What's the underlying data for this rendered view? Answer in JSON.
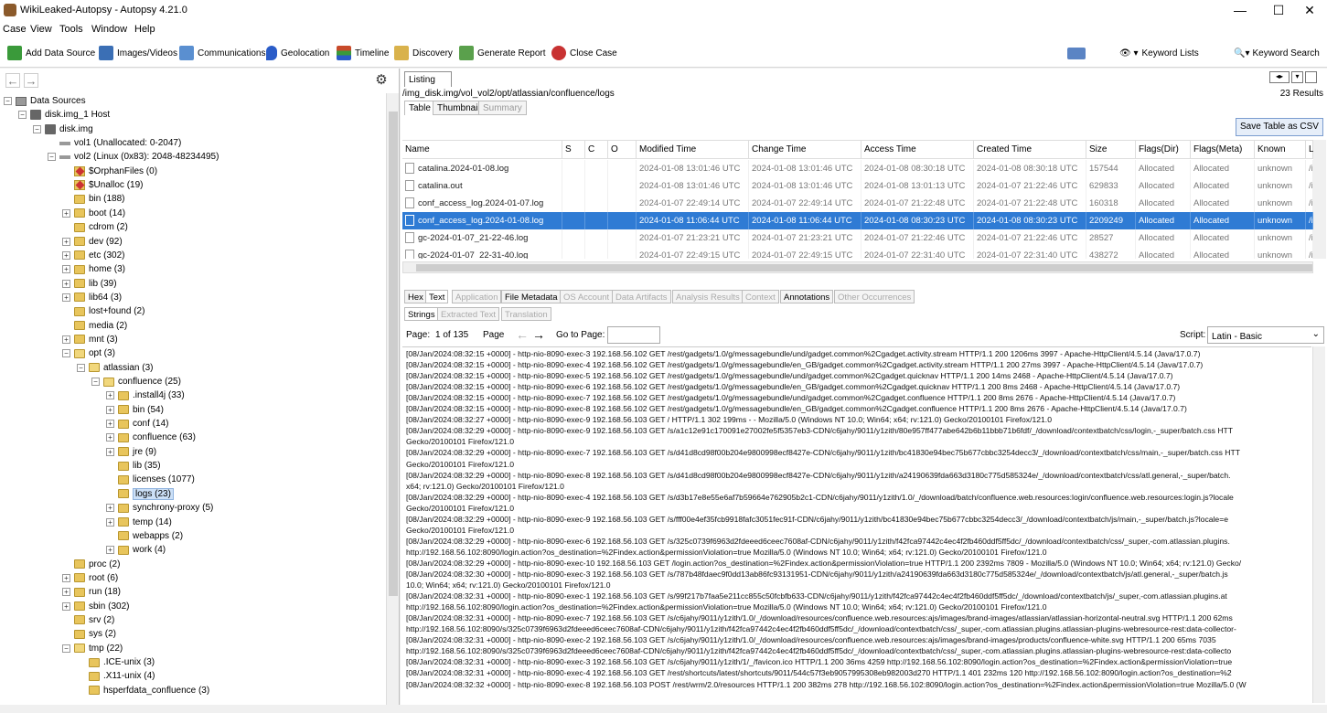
{
  "window": {
    "title": "WikiLeaked-Autopsy - Autopsy 4.21.0",
    "minimize": "—",
    "maximize": "☐",
    "close": "✕"
  },
  "menu": [
    "Case",
    "View",
    "Tools",
    "Window",
    "Help"
  ],
  "toolbar": {
    "add_data_source": "Add Data Source",
    "images_videos": "Images/Videos",
    "communications": "Communications",
    "geolocation": "Geolocation",
    "timeline": "Timeline",
    "discovery": "Discovery",
    "generate_report": "Generate Report",
    "close_case": "Close Case",
    "keyword_lists": "Keyword Lists",
    "keyword_search": "Keyword Search",
    "colors": {
      "add": "#3a9a3a",
      "images": "#3b6fb5",
      "comms": "#5a8fd0",
      "geo": "#2a5cc8",
      "timeline": "#c84a2a",
      "discovery": "#d9b24c",
      "report": "#5aa04c",
      "close": "#c83232"
    }
  },
  "tree": [
    {
      "label": "Data Sources",
      "toggle": "−",
      "icon": "ds"
    },
    {
      "label": "disk.img_1 Host",
      "toggle": "−",
      "icon": "disk"
    },
    {
      "label": "disk.img",
      "toggle": "−",
      "icon": "disk"
    },
    {
      "label": "vol1 (Unallocated: 0-2047)",
      "toggle": "",
      "icon": "vol"
    },
    {
      "label": "vol2 (Linux (0x83): 2048-48234495)",
      "toggle": "−",
      "icon": "vol"
    },
    {
      "label": "$OrphanFiles (0)",
      "toggle": "",
      "icon": "fx"
    },
    {
      "label": "$Unalloc (19)",
      "toggle": "",
      "icon": "fx"
    },
    {
      "label": "bin (188)",
      "toggle": "",
      "icon": "fd"
    },
    {
      "label": "boot (14)",
      "toggle": "+",
      "icon": "fd"
    },
    {
      "label": "cdrom (2)",
      "toggle": "",
      "icon": "fd"
    },
    {
      "label": "dev (92)",
      "toggle": "+",
      "icon": "fd"
    },
    {
      "label": "etc (302)",
      "toggle": "+",
      "icon": "fd"
    },
    {
      "label": "home (3)",
      "toggle": "+",
      "icon": "fd"
    },
    {
      "label": "lib (39)",
      "toggle": "+",
      "icon": "fd"
    },
    {
      "label": "lib64 (3)",
      "toggle": "+",
      "icon": "fd"
    },
    {
      "label": "lost+found (2)",
      "toggle": "",
      "icon": "fd"
    },
    {
      "label": "media (2)",
      "toggle": "",
      "icon": "fd"
    },
    {
      "label": "mnt (3)",
      "toggle": "+",
      "icon": "fd"
    },
    {
      "label": "opt (3)",
      "toggle": "−",
      "icon": "fdo"
    },
    {
      "label": "atlassian (3)",
      "toggle": "−",
      "icon": "fdo"
    },
    {
      "label": "confluence (25)",
      "toggle": "−",
      "icon": "fdo"
    },
    {
      "label": ".install4j (33)",
      "toggle": "+",
      "icon": "fd"
    },
    {
      "label": "bin (54)",
      "toggle": "+",
      "icon": "fd"
    },
    {
      "label": "conf (14)",
      "toggle": "+",
      "icon": "fd"
    },
    {
      "label": "confluence (63)",
      "toggle": "+",
      "icon": "fd"
    },
    {
      "label": "jre (9)",
      "toggle": "+",
      "icon": "fd"
    },
    {
      "label": "lib (35)",
      "toggle": "",
      "icon": "fd"
    },
    {
      "label": "licenses (1077)",
      "toggle": "",
      "icon": "fd"
    },
    {
      "label": "logs (23)",
      "toggle": "",
      "icon": "fd",
      "selected": true
    },
    {
      "label": "synchrony-proxy (5)",
      "toggle": "+",
      "icon": "fd"
    },
    {
      "label": "temp (14)",
      "toggle": "+",
      "icon": "fd"
    },
    {
      "label": "webapps (2)",
      "toggle": "",
      "icon": "fd"
    },
    {
      "label": "work (4)",
      "toggle": "+",
      "icon": "fd"
    },
    {
      "label": "proc (2)",
      "toggle": "",
      "icon": "fd"
    },
    {
      "label": "root (6)",
      "toggle": "+",
      "icon": "fd"
    },
    {
      "label": "run (18)",
      "toggle": "+",
      "icon": "fd"
    },
    {
      "label": "sbin (302)",
      "toggle": "+",
      "icon": "fd"
    },
    {
      "label": "srv (2)",
      "toggle": "",
      "icon": "fd"
    },
    {
      "label": "sys (2)",
      "toggle": "",
      "icon": "fd"
    },
    {
      "label": "tmp (22)",
      "toggle": "−",
      "icon": "fdo"
    },
    {
      "label": ".ICE-unix (3)",
      "toggle": "",
      "icon": "fd"
    },
    {
      "label": ".X11-unix (4)",
      "toggle": "",
      "icon": "fd"
    },
    {
      "label": "hsperfdata_confluence (3)",
      "toggle": "",
      "icon": "fd"
    }
  ],
  "listing": {
    "tab": "Listing",
    "path": "/img_disk.img/vol_vol2/opt/atlassian/confluence/logs",
    "result_count": "23 Results",
    "view_tabs": [
      "Table",
      "Thumbnail",
      "Summary"
    ],
    "save_csv": "Save Table as CSV",
    "columns": [
      "Name",
      "S",
      "C",
      "O",
      "Modified Time",
      "Change Time",
      "Access Time",
      "Created Time",
      "Size",
      "Flags(Dir)",
      "Flags(Meta)",
      "Known",
      "L"
    ],
    "rows": [
      [
        "catalina.2024-01-08.log",
        "",
        "",
        "",
        "2024-01-08 13:01:46 UTC",
        "2024-01-08 13:01:46 UTC",
        "2024-01-08 08:30:18 UTC",
        "2024-01-08 08:30:18 UTC",
        "157544",
        "Allocated",
        "Allocated",
        "unknown",
        "/i"
      ],
      [
        "catalina.out",
        "",
        "",
        "",
        "2024-01-08 13:01:46 UTC",
        "2024-01-08 13:01:46 UTC",
        "2024-01-08 13:01:13 UTC",
        "2024-01-07 21:22:46 UTC",
        "629833",
        "Allocated",
        "Allocated",
        "unknown",
        "/i"
      ],
      [
        "conf_access_log.2024-01-07.log",
        "",
        "",
        "",
        "2024-01-07 22:49:14 UTC",
        "2024-01-07 22:49:14 UTC",
        "2024-01-07 21:22:48 UTC",
        "2024-01-07 21:22:48 UTC",
        "160318",
        "Allocated",
        "Allocated",
        "unknown",
        "/i"
      ],
      [
        "conf_access_log.2024-01-08.log",
        "",
        "",
        "",
        "2024-01-08 11:06:44 UTC",
        "2024-01-08 11:06:44 UTC",
        "2024-01-08 08:30:23 UTC",
        "2024-01-08 08:30:23 UTC",
        "2209249",
        "Allocated",
        "Allocated",
        "unknown",
        "/i"
      ],
      [
        "gc-2024-01-07_21-22-46.log",
        "",
        "",
        "",
        "2024-01-07 21:23:21 UTC",
        "2024-01-07 21:23:21 UTC",
        "2024-01-07 21:22:46 UTC",
        "2024-01-07 21:22:46 UTC",
        "28527",
        "Allocated",
        "Allocated",
        "unknown",
        "/i"
      ],
      [
        "gc-2024-01-07_22-31-40.log",
        "",
        "",
        "",
        "2024-01-07 22:49:15 UTC",
        "2024-01-07 22:49:15 UTC",
        "2024-01-07 22:31:40 UTC",
        "2024-01-07 22:31:40 UTC",
        "438272",
        "Allocated",
        "Allocated",
        "unknown",
        "/i"
      ]
    ],
    "selected_row": 3
  },
  "content": {
    "tabs": [
      "Hex",
      "Text",
      "Application",
      "File Metadata",
      "OS Account",
      "Data Artifacts",
      "Analysis Results",
      "Context",
      "Annotations",
      "Other Occurrences"
    ],
    "subtabs": [
      "Strings",
      "Extracted Text",
      "Translation"
    ],
    "page_label": "Page:",
    "page_of": "1 of 135",
    "page_word": "Page",
    "goto_label": "Go to Page:",
    "script_label": "Script:",
    "script_value": "Latin - Basic",
    "lines": [
      "[08/Jan/2024:08:32:15 +0000] - http-nio-8090-exec-3 192.168.56.102 GET /rest/gadgets/1.0/g/messagebundle/und/gadget.common%2Cgadget.activity.stream HTTP/1.1 200 1206ms 3997 - Apache-HttpClient/4.5.14 (Java/17.0.7)",
      "[08/Jan/2024:08:32:15 +0000] - http-nio-8090-exec-4 192.168.56.102 GET /rest/gadgets/1.0/g/messagebundle/en_GB/gadget.common%2Cgadget.activity.stream HTTP/1.1 200 27ms 3997 - Apache-HttpClient/4.5.14 (Java/17.0.7)",
      "[08/Jan/2024:08:32:15 +0000] - http-nio-8090-exec-5 192.168.56.102 GET /rest/gadgets/1.0/g/messagebundle/und/gadget.common%2Cgadget.quicknav HTTP/1.1 200 14ms 2468 - Apache-HttpClient/4.5.14 (Java/17.0.7)",
      "[08/Jan/2024:08:32:15 +0000] - http-nio-8090-exec-6 192.168.56.102 GET /rest/gadgets/1.0/g/messagebundle/en_GB/gadget.common%2Cgadget.quicknav HTTP/1.1 200 8ms 2468 - Apache-HttpClient/4.5.14 (Java/17.0.7)",
      "[08/Jan/2024:08:32:15 +0000] - http-nio-8090-exec-7 192.168.56.102 GET /rest/gadgets/1.0/g/messagebundle/und/gadget.common%2Cgadget.confluence HTTP/1.1 200 8ms 2676 - Apache-HttpClient/4.5.14 (Java/17.0.7)",
      "[08/Jan/2024:08:32:15 +0000] - http-nio-8090-exec-8 192.168.56.102 GET /rest/gadgets/1.0/g/messagebundle/en_GB/gadget.common%2Cgadget.confluence HTTP/1.1 200 8ms 2676 - Apache-HttpClient/4.5.14 (Java/17.0.7)",
      "[08/Jan/2024:08:32:27 +0000] - http-nio-8090-exec-9 192.168.56.103 GET / HTTP/1.1 302 199ms - - Mozilla/5.0 (Windows NT 10.0; Win64; x64; rv:121.0) Gecko/20100101 Firefox/121.0",
      "[08/Jan/2024:08:32:29 +0000] - http-nio-8090-exec-9 192.168.56.103 GET /s/a1c12e91c170091e27002fe5f5357eb3-CDN/c6jahy/9011/y1zith/80e957ff477abe642b6b11bbb71b6fdf/_/download/contextbatch/css/login,-_super/batch.css HTT",
      "Gecko/20100101 Firefox/121.0",
      "[08/Jan/2024:08:32:29 +0000] - http-nio-8090-exec-7 192.168.56.103 GET /s/d41d8cd98f00b204e9800998ecf8427e-CDN/c6jahy/9011/y1zith/bc41830e94bec75b677cbbc3254decc3/_/download/contextbatch/css/main,-_super/batch.css HTT",
      "Gecko/20100101 Firefox/121.0",
      "[08/Jan/2024:08:32:29 +0000] - http-nio-8090-exec-8 192.168.56.103 GET /s/d41d8cd98f00b204e9800998ecf8427e-CDN/c6jahy/9011/y1zith/a24190639fda663d3180c775d585324e/_/download/contextbatch/css/atl.general,-_super/batch.",
      "x64; rv:121.0) Gecko/20100101 Firefox/121.0",
      "[08/Jan/2024:08:32:29 +0000] - http-nio-8090-exec-4 192.168.56.103 GET /s/d3b17e8e55e6af7b59664e762905b2c1-CDN/c6jahy/9011/y1zith/1.0/_/download/batch/confluence.web.resources:login/confluence.web.resources:login.js?locale",
      "Gecko/20100101 Firefox/121.0",
      "[08/Jan/2024:08:32:29 +0000] - http-nio-8090-exec-9 192.168.56.103 GET /s/fff00e4ef35fcb9918fafc3051fec91f-CDN/c6jahy/9011/y1zith/bc41830e94bec75b677cbbc3254decc3/_/download/contextbatch/js/main,-_super/batch.js?locale=e",
      "Gecko/20100101 Firefox/121.0",
      "[08/Jan/2024:08:32:29 +0000] - http-nio-8090-exec-6 192.168.56.103 GET /s/325c0739f6963d2fdeeed6ceec7608af-CDN/c6jahy/9011/y1zith/f42fca97442c4ec4f2fb460ddf5ff5dc/_/download/contextbatch/css/_super,-com.atlassian.plugins.",
      "http://192.168.56.102:8090/login.action?os_destination=%2Findex.action&permissionViolation=true Mozilla/5.0 (Windows NT 10.0; Win64; x64; rv:121.0) Gecko/20100101 Firefox/121.0",
      "[08/Jan/2024:08:32:29 +0000] - http-nio-8090-exec-10 192.168.56.103 GET /login.action?os_destination=%2Findex.action&permissionViolation=true HTTP/1.1 200 2392ms 7809 - Mozilla/5.0 (Windows NT 10.0; Win64; x64; rv:121.0) Gecko/",
      "[08/Jan/2024:08:32:30 +0000] - http-nio-8090-exec-3 192.168.56.103 GET /s/787b48fdaec9f0dd13ab86fc93131951-CDN/c6jahy/9011/y1zith/a24190639fda663d3180c775d585324e/_/download/contextbatch/js/atl.general,-_super/batch.js",
      "10.0; Win64; x64; rv:121.0) Gecko/20100101 Firefox/121.0",
      "[08/Jan/2024:08:32:31 +0000] - http-nio-8090-exec-1 192.168.56.103 GET /s/99f217b7faa5e211cc855c50fcbfb633-CDN/c6jahy/9011/y1zith/f42fca97442c4ec4f2fb460ddf5ff5dc/_/download/contextbatch/js/_super,-com.atlassian.plugins.at",
      "http://192.168.56.102:8090/login.action?os_destination=%2Findex.action&permissionViolation=true Mozilla/5.0 (Windows NT 10.0; Win64; x64; rv:121.0) Gecko/20100101 Firefox/121.0",
      "[08/Jan/2024:08:32:31 +0000] - http-nio-8090-exec-7 192.168.56.103 GET /s/c6jahy/9011/y1zith/1.0/_/download/resources/confluence.web.resources:ajs/images/brand-images/atlassian/atlassian-horizontal-neutral.svg HTTP/1.1 200 62ms",
      "http://192.168.56.102:8090/s/325c0739f6963d2fdeeed6ceec7608af-CDN/c6jahy/9011/y1zith/f42fca97442c4ec4f2fb460ddf5ff5dc/_/download/contextbatch/css/_super,-com.atlassian.plugins.atlassian-plugins-webresource-rest:data-collector-",
      "[08/Jan/2024:08:32:31 +0000] - http-nio-8090-exec-2 192.168.56.103 GET /s/c6jahy/9011/y1zith/1.0/_/download/resources/confluence.web.resources:ajs/images/brand-images/products/confluence-white.svg HTTP/1.1 200 65ms 7035",
      "http://192.168.56.102:8090/s/325c0739f6963d2fdeeed6ceec7608af-CDN/c6jahy/9011/y1zith/f42fca97442c4ec4f2fb460ddf5ff5dc/_/download/contextbatch/css/_super,-com.atlassian.plugins.atlassian-plugins-webresource-rest:data-collecto",
      "[08/Jan/2024:08:32:31 +0000] - http-nio-8090-exec-3 192.168.56.103 GET /s/c6jahy/9011/y1zith/1/_/favicon.ico HTTP/1.1 200 36ms 4259 http://192.168.56.102:8090/login.action?os_destination=%2Findex.action&permissionViolation=true",
      "[08/Jan/2024:08:32:31 +0000] - http-nio-8090-exec-4 192.168.56.103 GET /rest/shortcuts/latest/shortcuts/9011/544c57f3eb9057995308eb982003d270 HTTP/1.1 401 232ms 120 http://192.168.56.102:8090/login.action?os_destination=%2",
      "[08/Jan/2024:08:32:32 +0000] - http-nio-8090-exec-8 192.168.56.103 POST /rest/wrm/2.0/resources HTTP/1.1 200 382ms 278 http://192.168.56.102:8090/login.action?os_destination=%2Findex.action&permissionViolation=true Mozilla/5.0 (W"
    ]
  }
}
